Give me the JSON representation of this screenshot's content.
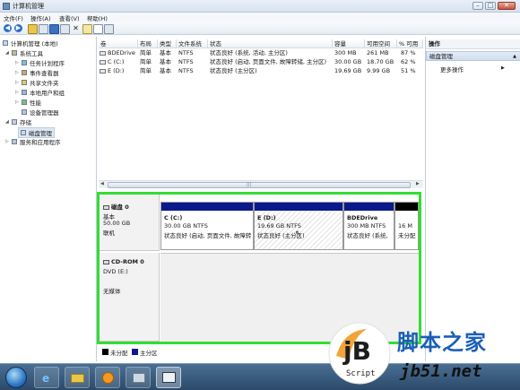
{
  "window": {
    "title": "计算机管理",
    "min": "–",
    "max": "□",
    "close": "✕"
  },
  "menu": [
    "文件(F)",
    "操作(A)",
    "查看(V)",
    "帮助(H)"
  ],
  "toolbar": {
    "back": "◀",
    "forward": "▶",
    "delete": "✕"
  },
  "tree": {
    "root": "计算机管理 (本地)",
    "system_tools": "系统工具",
    "task_scheduler": "任务计划程序",
    "event_viewer": "事件查看器",
    "shared_folders": "共享文件夹",
    "local_users": "本地用户和组",
    "performance": "性能",
    "device_manager": "设备管理器",
    "storage": "存储",
    "disk_management": "磁盘管理",
    "services": "服务和应用程序"
  },
  "volume_list": {
    "columns": [
      "卷",
      "布局",
      "类型",
      "文件系统",
      "状态",
      "容量",
      "可用空间",
      "% 可用"
    ],
    "rows": [
      [
        "BDEDrive",
        "简单",
        "基本",
        "NTFS",
        "状态良好 (系统, 活动, 主分区)",
        "300 MB",
        "261 MB",
        "87 %"
      ],
      [
        "C (C:)",
        "简单",
        "基本",
        "NTFS",
        "状态良好 (启动, 页面文件, 故障转储, 主分区)",
        "30.00 GB",
        "18.70 GB",
        "62 %"
      ],
      [
        "E (D:)",
        "简单",
        "基本",
        "NTFS",
        "状态良好 (主分区)",
        "19.69 GB",
        "9.99 GB",
        "51 %"
      ]
    ]
  },
  "scroll_grip": "|||",
  "scroll_left": "◀",
  "scroll_right": "▶",
  "actions": {
    "header": "操作",
    "section": "磁盘管理",
    "more": "更多操作",
    "section_arrow": "▲",
    "more_arrow": "▶"
  },
  "disk0": {
    "name": "磁盘 0",
    "type": "基本",
    "size": "50.00 GB",
    "status": "联机",
    "partitions": [
      {
        "name": "C  (C:)",
        "size": "30.00 GB NTFS",
        "status": "状态良好 (启动, 页面文件, 故障转",
        "bar_color": "#0a1a8c"
      },
      {
        "name": "E  (D:)",
        "size": "19.69 GB NTFS",
        "status": "状态良好 (主分区)",
        "bar_color": "#0a1a8c"
      },
      {
        "name": "BDEDrive",
        "size": "300 MB NTFS",
        "status": "状态良好 (系统,",
        "bar_color": "#0a1a8c"
      },
      {
        "name": "",
        "size": "16 M",
        "status": "未分配",
        "bar_color": "#000000"
      }
    ]
  },
  "cdrom0": {
    "name": "CD-ROM 0",
    "type": "DVD (E:)",
    "status": "无媒体"
  },
  "legend": [
    {
      "label": "未分配",
      "color": "#000000"
    },
    {
      "label": "主分区",
      "color": "#0a1a8c"
    }
  ],
  "watermark": {
    "logo": "jB",
    "script": "Script",
    "text": "脚本之家",
    "url": "jb51.net"
  },
  "colors": {
    "highlight_border": "#33dd33",
    "partition_bar": "#0a1a8c",
    "taskbar": "#2b4a6b"
  }
}
